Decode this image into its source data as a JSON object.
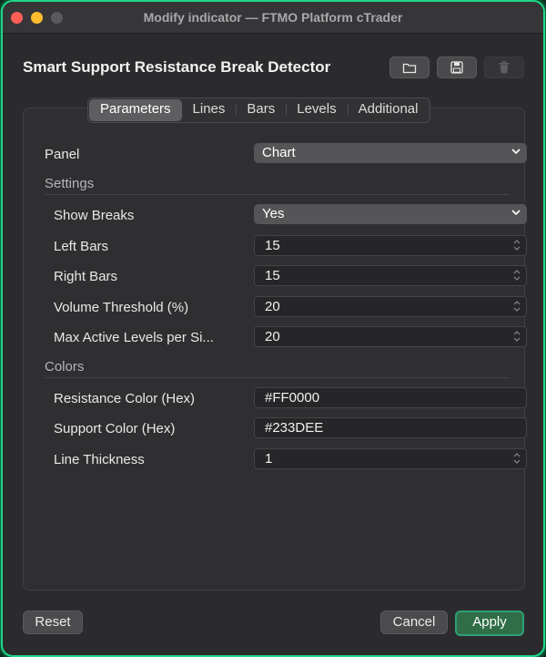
{
  "window": {
    "title": "Modify indicator — FTMO Platform cTrader"
  },
  "indicator": {
    "name": "Smart Support Resistance Break Detector"
  },
  "toolbar": {
    "open_icon": "folder-icon",
    "save_icon": "save-icon",
    "delete_icon": "trash-icon"
  },
  "tabs": [
    {
      "label": "Parameters",
      "active": true
    },
    {
      "label": "Lines"
    },
    {
      "label": "Bars"
    },
    {
      "label": "Levels"
    },
    {
      "label": "Additional"
    }
  ],
  "panel": {
    "label": "Panel",
    "value": "Chart"
  },
  "settings": {
    "header": "Settings",
    "show_breaks": {
      "label": "Show Breaks",
      "value": "Yes"
    },
    "left_bars": {
      "label": "Left Bars",
      "value": "15"
    },
    "right_bars": {
      "label": "Right Bars",
      "value": "15"
    },
    "volume_threshold": {
      "label": "Volume Threshold (%)",
      "value": "20"
    },
    "max_levels": {
      "label": "Max Active Levels per Si...",
      "value": "20"
    }
  },
  "colors": {
    "header": "Colors",
    "resistance": {
      "label": "Resistance Color (Hex)",
      "value": "#FF0000"
    },
    "support": {
      "label": "Support Color (Hex)",
      "value": "#233DEE"
    },
    "thickness": {
      "label": "Line Thickness",
      "value": "1"
    }
  },
  "buttons": {
    "reset": "Reset",
    "cancel": "Cancel",
    "apply": "Apply"
  },
  "theme": {
    "accent_glow": "#1fd68a",
    "apply_bg": "#2f6e46"
  }
}
